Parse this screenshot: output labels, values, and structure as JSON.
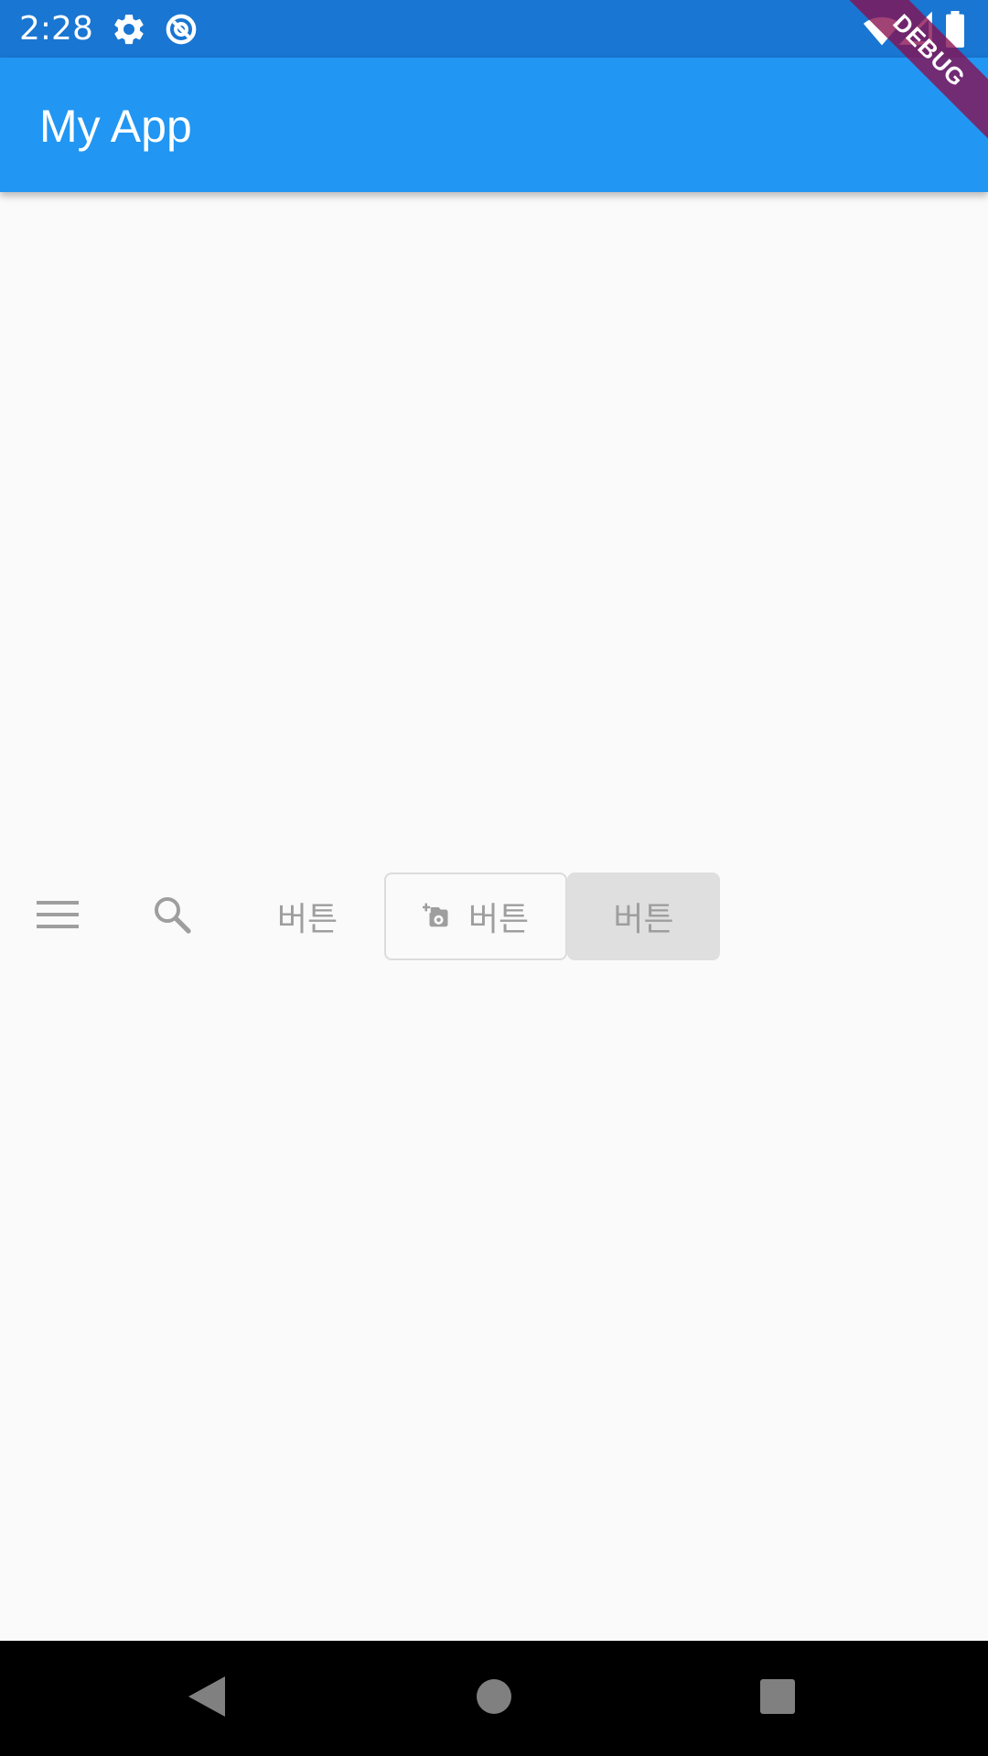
{
  "status_bar": {
    "time": "2:28",
    "left_icons": [
      "gear-icon",
      "data-saver-icon"
    ],
    "right_icons": [
      "wifi-icon",
      "cell-signal-icon",
      "battery-icon"
    ]
  },
  "app_bar": {
    "title": "My App"
  },
  "debug_banner": {
    "label": "DEBUG"
  },
  "button_row": {
    "menu_icon": "menu-icon",
    "search_icon": "search-icon",
    "text_button_label": "버튼",
    "outlined_button_icon": "add-a-photo-icon",
    "outlined_button_label": "버튼",
    "elevated_button_label": "버튼"
  },
  "nav_bar": {
    "buttons": [
      "back-icon",
      "home-icon",
      "recents-icon"
    ]
  },
  "colors": {
    "status_bar": "#1976d2",
    "app_bar": "#2196f3",
    "background": "#fafafa",
    "disabled_text": "#9e9e9e",
    "disabled_fill": "#dfdfdf",
    "debug_banner": "#880e4f"
  }
}
